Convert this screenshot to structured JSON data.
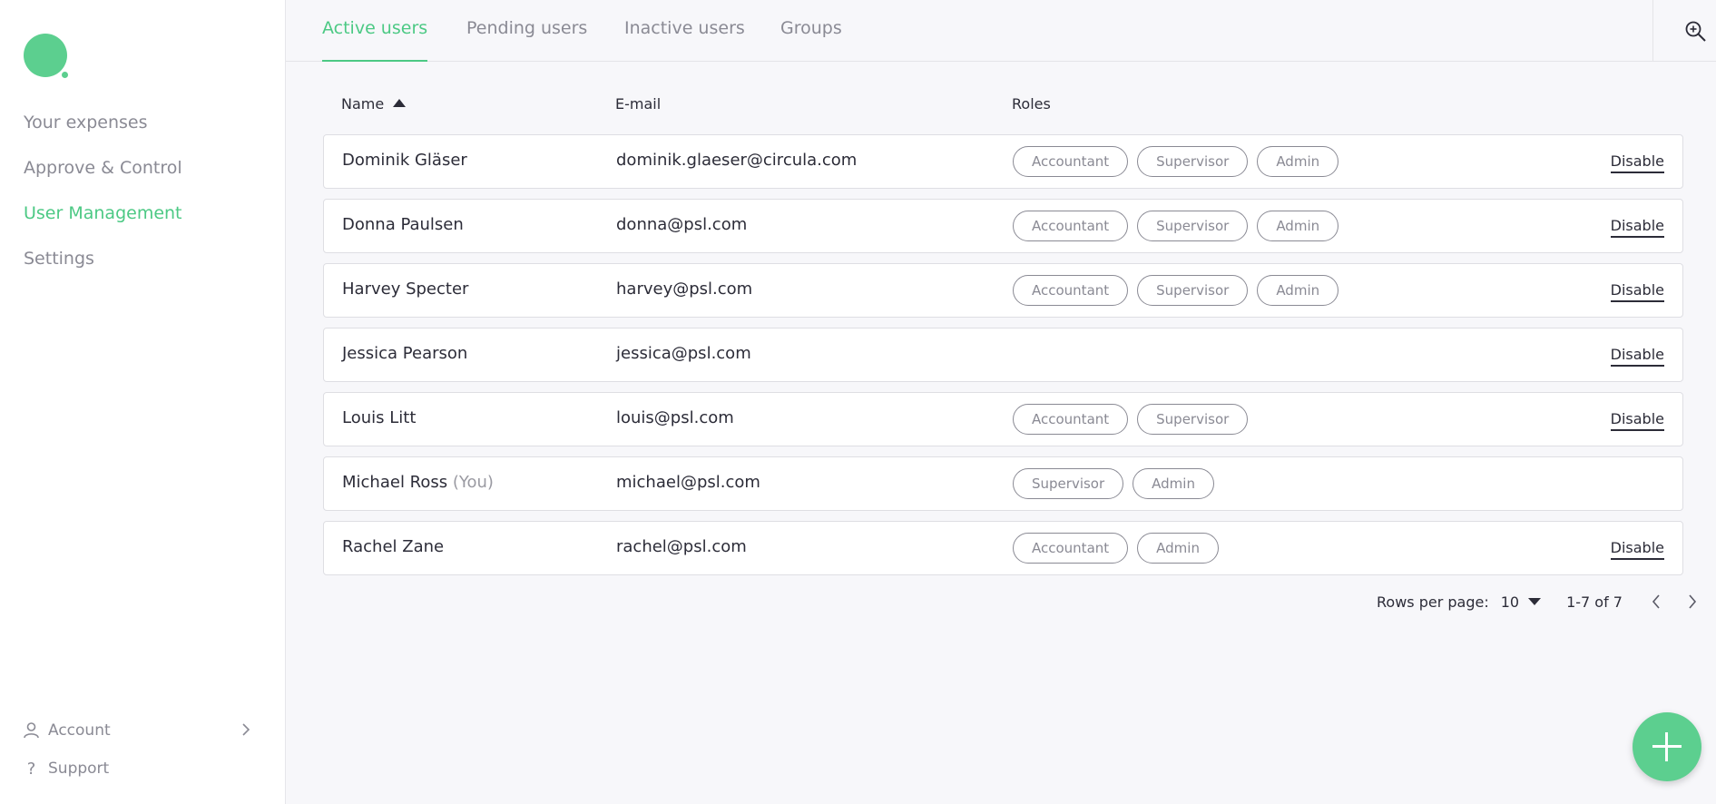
{
  "colors": {
    "accent": "#5ccf8f",
    "text": "#2c2c38",
    "muted": "#8a8a94"
  },
  "sidebar": {
    "logo_icon": "circula-logo",
    "items": [
      {
        "label": "Your expenses",
        "active": false
      },
      {
        "label": "Approve & Control",
        "active": false
      },
      {
        "label": "User Management",
        "active": true
      },
      {
        "label": "Settings",
        "active": false
      }
    ],
    "account": {
      "label": "Account",
      "icon": "user-icon"
    },
    "support": {
      "label": "Support",
      "icon": "question-icon"
    }
  },
  "tabs": [
    {
      "label": "Active users",
      "active": true
    },
    {
      "label": "Pending users",
      "active": false
    },
    {
      "label": "Inactive users",
      "active": false
    },
    {
      "label": "Groups",
      "active": false
    }
  ],
  "table": {
    "columns": {
      "name": "Name",
      "email": "E-mail",
      "roles": "Roles"
    },
    "sort": {
      "column": "name",
      "direction": "ascending"
    },
    "disable_label": "Disable",
    "rows": [
      {
        "name": "Dominik Gläser",
        "you": "",
        "email": "dominik.glaeser@circula.com",
        "roles": [
          "Accountant",
          "Supervisor",
          "Admin"
        ],
        "can_disable": true
      },
      {
        "name": "Donna Paulsen",
        "you": "",
        "email": "donna@psl.com",
        "roles": [
          "Accountant",
          "Supervisor",
          "Admin"
        ],
        "can_disable": true
      },
      {
        "name": "Harvey Specter",
        "you": "",
        "email": "harvey@psl.com",
        "roles": [
          "Accountant",
          "Supervisor",
          "Admin"
        ],
        "can_disable": true
      },
      {
        "name": "Jessica Pearson",
        "you": "",
        "email": "jessica@psl.com",
        "roles": [],
        "can_disable": true
      },
      {
        "name": "Louis Litt",
        "you": "",
        "email": "louis@psl.com",
        "roles": [
          "Accountant",
          "Supervisor"
        ],
        "can_disable": true
      },
      {
        "name": "Michael Ross",
        "you": "(You)",
        "email": "michael@psl.com",
        "roles": [
          "Supervisor",
          "Admin"
        ],
        "can_disable": false
      },
      {
        "name": "Rachel Zane",
        "you": "",
        "email": "rachel@psl.com",
        "roles": [
          "Accountant",
          "Admin"
        ],
        "can_disable": true
      }
    ]
  },
  "pagination": {
    "rows_per_page_label": "Rows per page:",
    "rows_per_page": "10",
    "range": "1-7 of 7"
  }
}
